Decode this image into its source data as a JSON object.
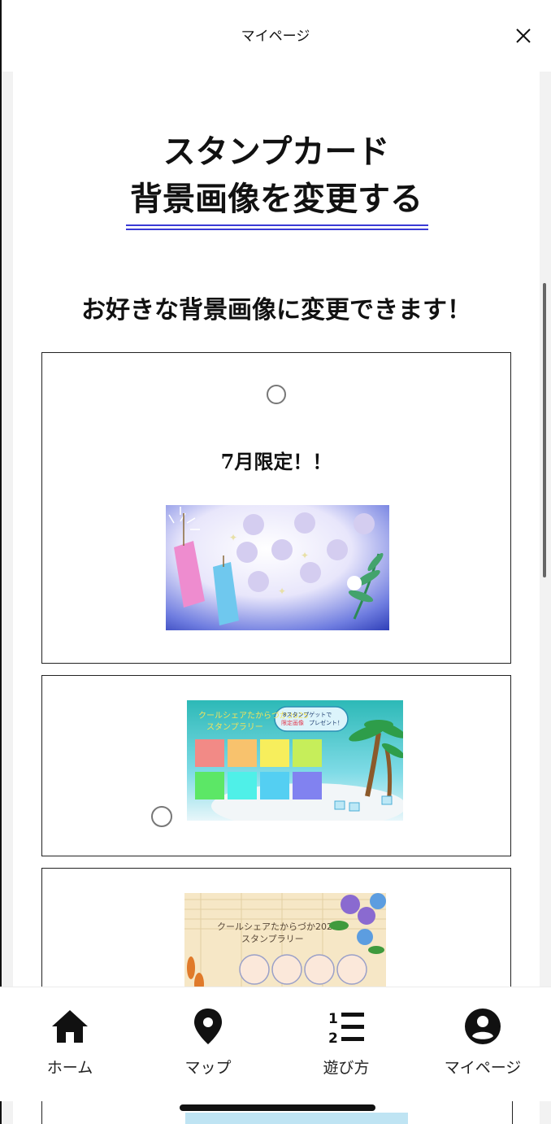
{
  "header": {
    "title": "マイページ",
    "close_icon": "close-icon"
  },
  "page": {
    "heading_line1": "スタンプカード",
    "heading_line2": "背景画像を変更する",
    "subtitle": "お好きな背景画像に変更できます！",
    "accent_color": "#3a3ad6"
  },
  "options": [
    {
      "label": "7月限定！！",
      "selected": false,
      "image": "tanabata-stamp-card"
    },
    {
      "label": "",
      "selected": false,
      "image": "summer-beach-stamp-card",
      "image_text": [
        "クールシェアたからづか2025",
        "スタンプラリー",
        "8スタンプゲットで",
        "限定画像",
        "プレゼント！"
      ]
    },
    {
      "label": "",
      "selected": false,
      "image": "morning-glory-stamp-card",
      "image_text": [
        "クールシェアたからづか2025",
        "スタンプラリー"
      ]
    }
  ],
  "bottom_nav": [
    {
      "label": "ホーム",
      "icon": "home-icon"
    },
    {
      "label": "マップ",
      "icon": "map-pin-icon"
    },
    {
      "label": "遊び方",
      "icon": "numbered-list-icon"
    },
    {
      "label": "マイページ",
      "icon": "account-circle-icon"
    }
  ]
}
